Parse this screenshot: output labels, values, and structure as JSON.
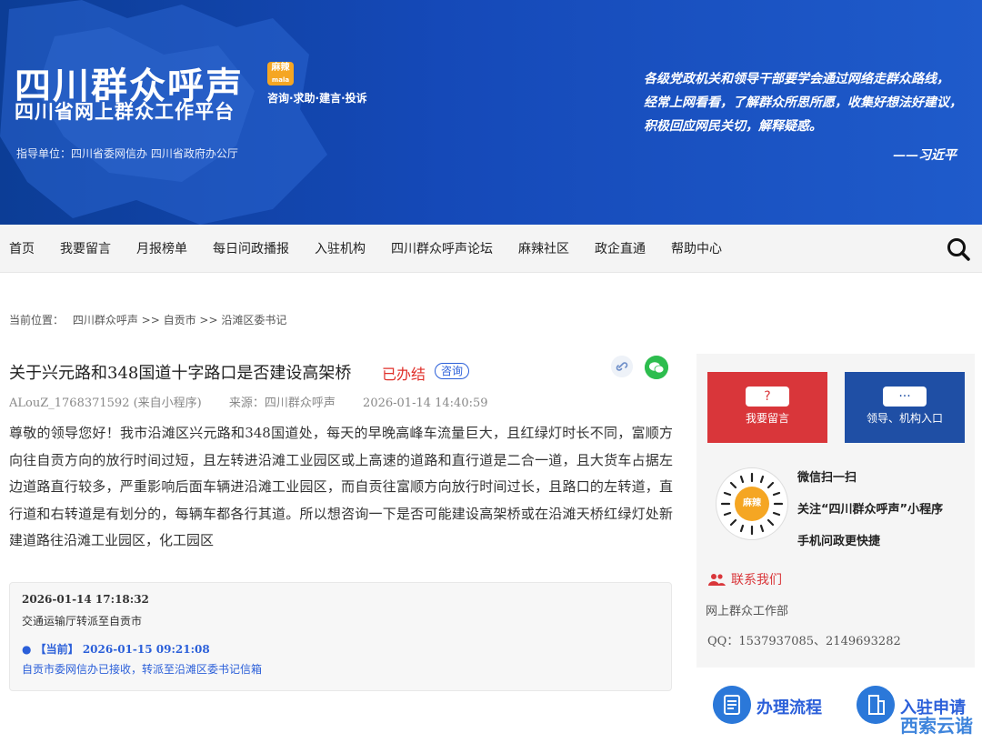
{
  "header": {
    "title": "四川群众呼声",
    "subtitle": "四川省网上群众工作平台",
    "badge": "麻辣",
    "slogan": "咨询·求助·建言·投诉",
    "guide": "指导单位：四川省委网信办 四川省政府办公厅",
    "quote_lines": [
      "各级党政机关和领导干部要学会通过网络走群众路线，",
      "经常上网看看，了解群众所思所愿，收集好想法好建议，",
      "积极回应网民关切，解释疑惑。"
    ],
    "quote_author": "——习近平",
    "colors": {
      "banner": "#1549b8",
      "accent_red": "#e0302a",
      "link_blue": "#2b5fd9"
    }
  },
  "nav": {
    "items": [
      "首页",
      "我要留言",
      "月报榜单",
      "每日问政播报",
      "入驻机构",
      "四川群众呼声论坛",
      "麻辣社区",
      "政企直通",
      "帮助中心"
    ],
    "search_icon": "search-icon"
  },
  "breadcrumb": {
    "label": "当前位置：",
    "path": "四川群众呼声 >> 自贡市 >> 沿滩区委书记"
  },
  "post": {
    "title": "关于兴元路和348国道十字路口是否建设高架桥",
    "status": "已办结",
    "type": "咨询",
    "author": "ALouZ_1768371592 (来自小程序)",
    "source": "来源：四川群众呼声",
    "time": "2026-01-14 14:40:59",
    "body": "尊敬的领导您好！我市沿滩区兴元路和348国道处，每天的早晚高峰车流量巨大，且红绿灯时长不同，富顺方向往自贡方向的放行时间过短，且左转进沿滩工业园区或上高速的道路和直行道是二合一道，且大货车占据左边道路直行较多，严重影响后面车辆进沿滩工业园区，而自贡往富顺方向放行时间过长，且路口的左转道，直行道和右转道是有划分的，每辆车都各行其道。所以想咨询一下是否可能建设高架桥或在沿滩天桥红绿灯处新建道路往沿滩工业园区，化工园区"
  },
  "timeline": {
    "entries": [
      {
        "date": "2026-01-14 17:18:32",
        "text": "交通运输厅转派至自贡市"
      },
      {
        "date": "● 【当前】 2026-01-15 09:21:08",
        "text": "自贡市委网信办已接收，转派至沿滩区委书记信箱"
      }
    ]
  },
  "sidebar": {
    "btn_message": {
      "icon": "?",
      "label": "我要留言"
    },
    "btn_leader": {
      "icon": "···",
      "label": "领导、机构入口"
    },
    "qr_badge": "麻辣",
    "qr_lines": [
      "微信扫一扫",
      "关注“四川群众呼声”小程序",
      "手机问政更快捷"
    ],
    "contact_title": "联系我们",
    "contact_dept": "网上群众工作部",
    "contact_qq": "QQ：1537937085、2149693282"
  },
  "bottom": {
    "process": "办理流程",
    "apply": "入驻申请",
    "corner": "西索云谐"
  }
}
